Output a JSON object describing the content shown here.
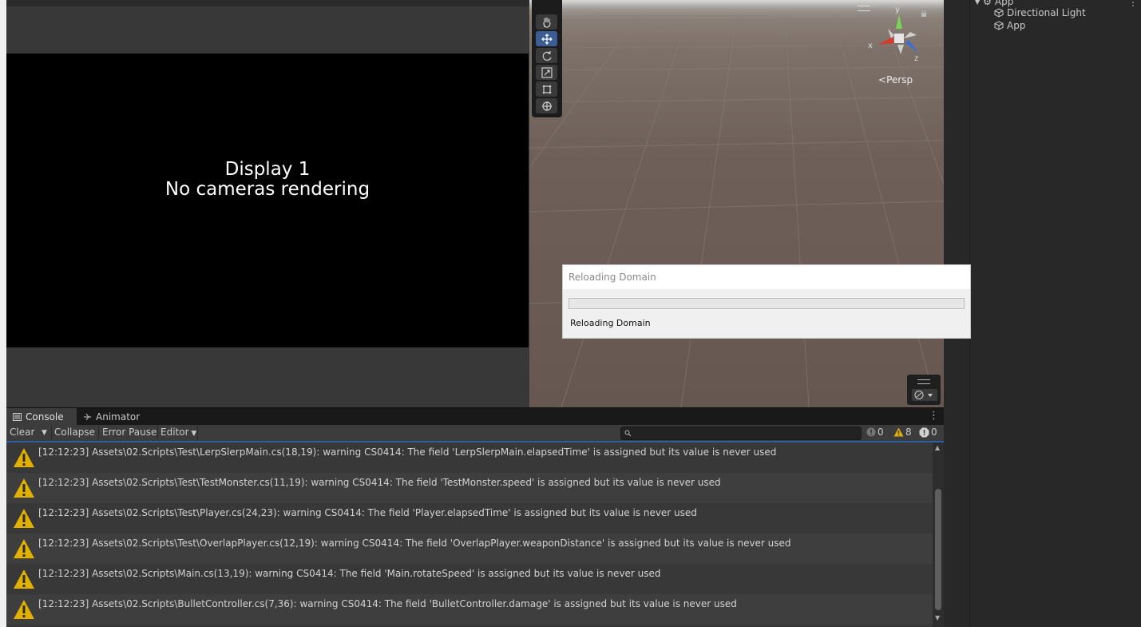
{
  "game_view": {
    "display_label": "Display 1",
    "message": "No cameras rendering"
  },
  "scene_view": {
    "tools": [
      "hand-tool",
      "move-tool",
      "rotate-tool",
      "scale-tool",
      "rect-tool",
      "transform-tool"
    ],
    "active_tool": "move-tool",
    "gizmo_axes": {
      "x": "x",
      "y": "y",
      "z": "z"
    },
    "projection_label": "Persp"
  },
  "hierarchy": {
    "root": "App",
    "items": [
      "Directional Light",
      "App"
    ]
  },
  "console": {
    "tabs": [
      {
        "label": "Console",
        "icon": "console-icon"
      },
      {
        "label": "Animator",
        "icon": "animator-icon"
      }
    ],
    "toolbar": {
      "clear": "Clear",
      "collapse": "Collapse",
      "error_pause": "Error Pause",
      "editor": "Editor"
    },
    "search_placeholder": "",
    "counts": {
      "info": "0",
      "warnings": "8",
      "errors": "0"
    },
    "logs": [
      "[12:12:23] Assets\\02.Scripts\\Test\\LerpSlerpMain.cs(18,19): warning CS0414: The field 'LerpSlerpMain.elapsedTime' is assigned but its value is never used",
      "[12:12:23] Assets\\02.Scripts\\Test\\TestMonster.cs(11,19): warning CS0414: The field 'TestMonster.speed' is assigned but its value is never used",
      "[12:12:23] Assets\\02.Scripts\\Test\\Player.cs(24,23): warning CS0414: The field 'Player.elapsedTime' is assigned but its value is never used",
      "[12:12:23] Assets\\02.Scripts\\Test\\OverlapPlayer.cs(12,19): warning CS0414: The field 'OverlapPlayer.weaponDistance' is assigned but its value is never used",
      "[12:12:23] Assets\\02.Scripts\\Main.cs(13,19): warning CS0414: The field 'Main.rotateSpeed' is assigned but its value is never used",
      "[12:12:23] Assets\\02.Scripts\\BulletController.cs(7,36): warning CS0414: The field 'BulletController.damage' is assigned but its value is never used"
    ]
  },
  "dialog": {
    "title": "Reloading Domain",
    "status": "Reloading Domain",
    "progress": 0
  },
  "colors": {
    "accent": "#3c5d94",
    "warning": "#e0b100"
  }
}
